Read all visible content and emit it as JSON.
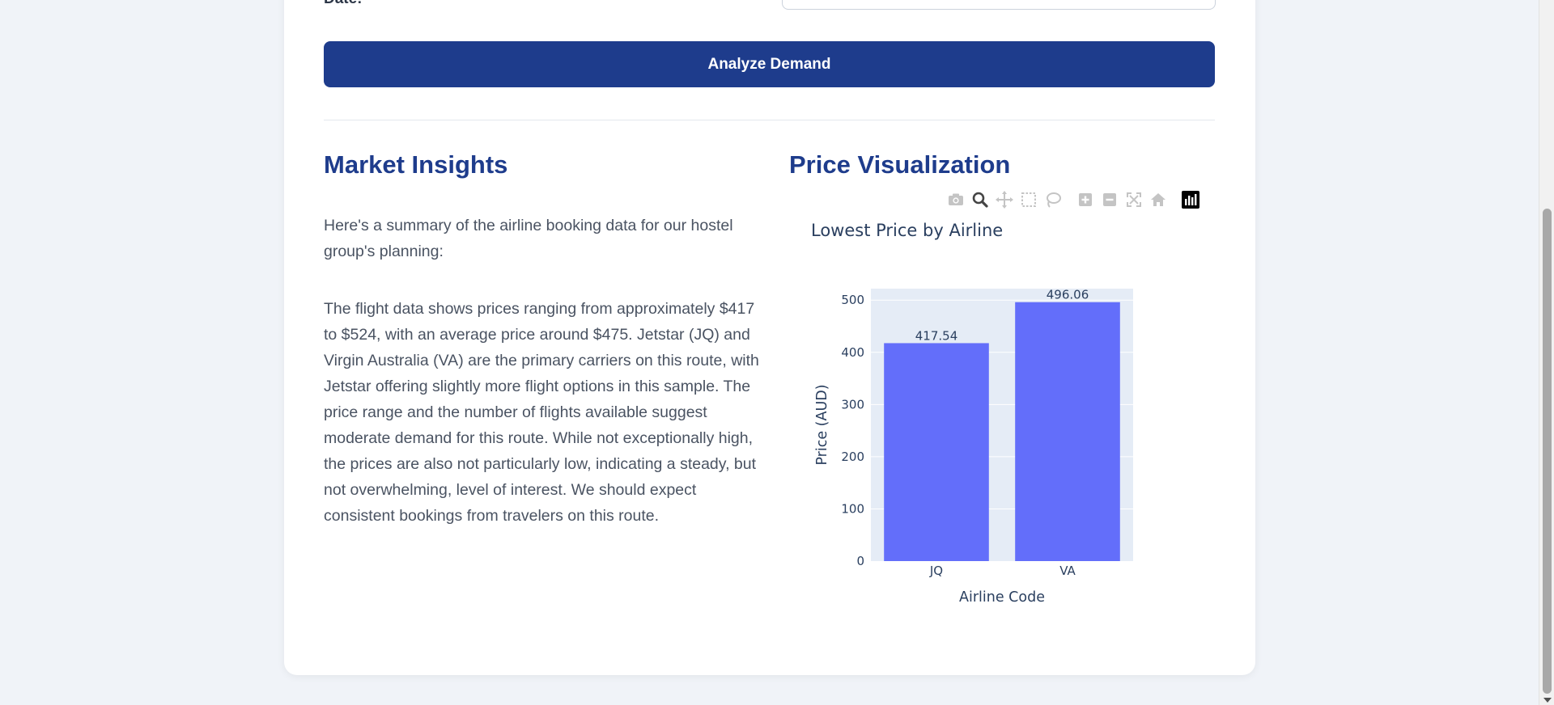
{
  "form": {
    "date_label": "Date:",
    "analyze_button": "Analyze Demand"
  },
  "insights": {
    "title": "Market Insights",
    "paragraphs": [
      "Here's a summary of the airline booking data for our hostel group's planning:",
      "The flight data shows prices ranging from approximately $417 to $524, with an average price around $475. Jetstar (JQ) and Virgin Australia (VA) are the primary carriers on this route, with Jetstar offering slightly more flight options in this sample. The price range and the number of flights available suggest moderate demand for this route. While not exceptionally high, the prices are also not particularly low, indicating a steady, but not overwhelming, level of interest. We should expect consistent bookings from travelers on this route."
    ]
  },
  "visualization": {
    "title": "Price Visualization",
    "modebar": [
      "camera-icon",
      "zoom-icon",
      "pan-icon",
      "box-select-icon",
      "lasso-icon",
      "zoom-in-icon",
      "zoom-out-icon",
      "autoscale-icon",
      "reset-axes-icon",
      "plotly-logo-icon"
    ]
  },
  "chart_data": {
    "type": "bar",
    "title": "Lowest Price by Airline",
    "categories": [
      "JQ",
      "VA"
    ],
    "values": [
      417.54,
      496.06
    ],
    "value_labels": [
      "417.54",
      "496.06"
    ],
    "xlabel": "Airline Code",
    "ylabel": "Price (AUD)",
    "ylim": [
      0,
      522
    ],
    "yticks": [
      "0",
      "100",
      "200",
      "300",
      "400",
      "500"
    ],
    "grid": true,
    "bar_color": "#636efa",
    "plot_bg": "#e5ecf6"
  },
  "colors": {
    "accent": "#1e3c8c",
    "page_bg": "#f0f3f8"
  }
}
